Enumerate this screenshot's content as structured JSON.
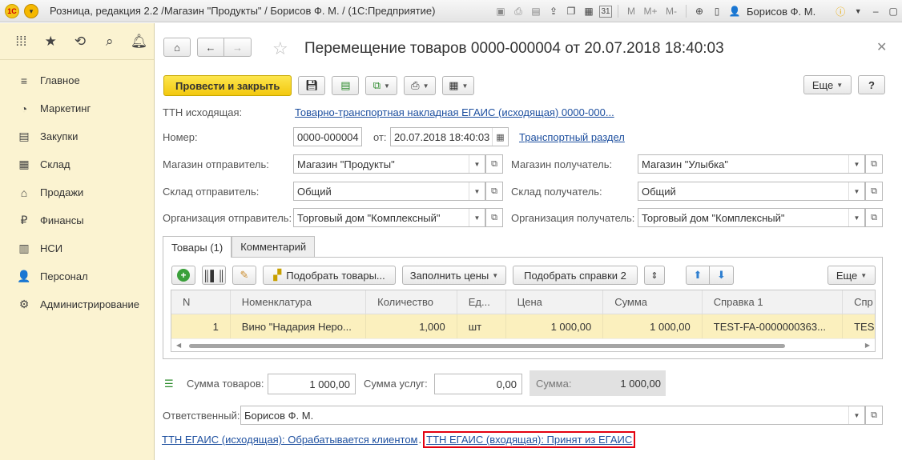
{
  "titlebar": {
    "logo": "1С",
    "title": "Розница, редакция 2.2 /Магазин \"Продукты\" / Борисов Ф. М. /  (1С:Предприятие)",
    "m_label": "M",
    "mplus_label": "M+",
    "mminus_label": "M-",
    "calendar_label": "31",
    "user": "Борисов Ф. М."
  },
  "sidebar": {
    "items": [
      {
        "label": "Главное",
        "icon": "menu-icon"
      },
      {
        "label": "Маркетинг",
        "icon": "pie-chart-icon"
      },
      {
        "label": "Закупки",
        "icon": "cart-icon"
      },
      {
        "label": "Склад",
        "icon": "warehouse-icon"
      },
      {
        "label": "Продажи",
        "icon": "basket-icon"
      },
      {
        "label": "Финансы",
        "icon": "ruble-icon"
      },
      {
        "label": "НСИ",
        "icon": "books-icon"
      },
      {
        "label": "Персонал",
        "icon": "person-icon"
      },
      {
        "label": "Администрирование",
        "icon": "gear-icon"
      }
    ]
  },
  "form": {
    "title": "Перемещение товаров 0000-000004 от 20.07.2018 18:40:03",
    "post_close": "Провести и закрыть",
    "more": "Еще",
    "help": "?",
    "ttn_label": "ТТН исходящая:",
    "ttn_link": "Товарно-транспортная накладная ЕГАИС (исходящая) 0000-000...",
    "number_label": "Номер:",
    "number_value": "0000-000004",
    "from_label": "от:",
    "date_value": "20.07.2018 18:40:03",
    "transport_link": "Транспортный раздел",
    "sender_store_label": "Магазин отправитель:",
    "sender_store_value": "Магазин \"Продукты\"",
    "receiver_store_label": "Магазин получатель:",
    "receiver_store_value": "Магазин \"Улыбка\"",
    "sender_wh_label": "Склад отправитель:",
    "sender_wh_value": "Общий",
    "receiver_wh_label": "Склад получатель:",
    "receiver_wh_value": "Общий",
    "sender_org_label": "Организация отправитель:",
    "sender_org_value": "Торговый дом \"Комплексный\"",
    "receiver_org_label": "Организация получатель:",
    "receiver_org_value": "Торговый дом \"Комплексный\""
  },
  "tabs": [
    {
      "label": "Товары (1)",
      "active": true
    },
    {
      "label": "Комментарий",
      "active": false
    }
  ],
  "goods_toolbar": {
    "pick_goods": "Подобрать товары...",
    "fill_prices": "Заполнить цены",
    "pick_certs": "Подобрать справки 2",
    "more": "Еще"
  },
  "table": {
    "columns": [
      "N",
      "Номенклатура",
      "Количество",
      "Ед...",
      "Цена",
      "Сумма",
      "Справка 1",
      "Спр"
    ],
    "rows": [
      [
        "1",
        "Вино \"Надария Нерo...",
        "1,000",
        "шт",
        "1 000,00",
        "1 000,00",
        "TEST-FA-0000000363...",
        "TES"
      ]
    ]
  },
  "totals": {
    "goods_label": "Сумма товаров:",
    "goods_value": "1 000,00",
    "services_label": "Сумма услуг:",
    "services_value": "0,00",
    "total_label": "Сумма:",
    "total_value": "1 000,00"
  },
  "responsible": {
    "label": "Ответственный:",
    "value": "Борисов Ф. М."
  },
  "status": {
    "outgoing": "ТТН ЕГАИС (исходящая): Обрабатывается клиентом",
    "separator": ".",
    "incoming": "ТТН ЕГАИС (входящая): Принят из ЕГАИС"
  },
  "colors": {
    "accent_yellow": "#f3c80f",
    "sidebar_bg": "#fbf3d1",
    "link": "#1d4f9f",
    "highlight_border": "#e3000f",
    "selected_row": "#fbf0be"
  }
}
